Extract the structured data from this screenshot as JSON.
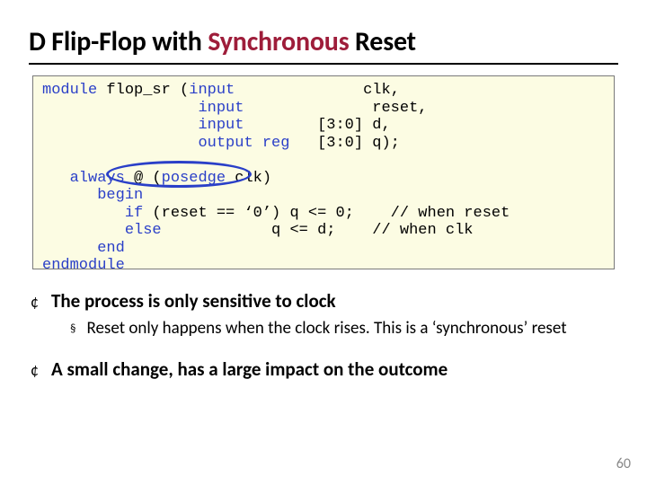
{
  "title": {
    "pre": "D Flip-Flop with ",
    "accent": "Synchronous",
    "post": " Reset"
  },
  "code": {
    "l1a": "module",
    "l1b": " flop_sr (",
    "l1c": "input",
    "l1d": "              clk,",
    "l2a": "                 ",
    "l2b": "input",
    "l2c": "              reset,",
    "l3a": "                 ",
    "l3b": "input",
    "l3c": "        [3:0] d,",
    "l4a": "                 ",
    "l4b": "output reg",
    "l4c": "   [3:0] q);",
    "blank1": "",
    "l5a": "   ",
    "l5b": "always",
    "l5c": " @ (",
    "l5d": "posedge",
    "l5e": " clk)",
    "l6a": "      ",
    "l6b": "begin",
    "l7a": "         ",
    "l7b": "if",
    "l7c": " (reset == ‘0’) q <= 0;    // when reset",
    "l8a": "         ",
    "l8b": "else",
    "l8c": "            q <= d;    // when clk",
    "l9a": "      ",
    "l9b": "end",
    "l10a": "endmodule"
  },
  "bullets": {
    "b1": "The process is only sensitive to clock",
    "b2": "Reset only happens when the clock rises. This is a ‘synchronous’ reset",
    "b3": "A small change, has a large impact on the outcome"
  },
  "page": "60"
}
